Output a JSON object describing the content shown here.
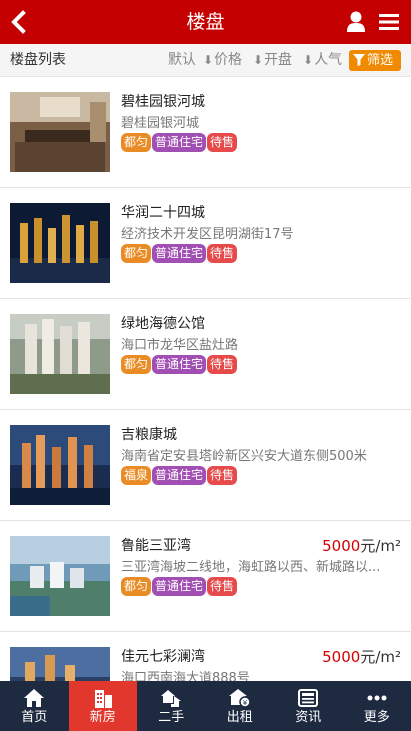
{
  "header": {
    "title": "楼盘"
  },
  "toolbar": {
    "label": "楼盘列表",
    "sort": {
      "default": "默认",
      "price": "价格",
      "open": "开盘",
      "popularity": "人气"
    },
    "filter": "筛选",
    "arrow": "⬇"
  },
  "listings": [
    {
      "name": "碧桂园银河城",
      "address": "碧桂园银河城",
      "price": "",
      "unit": "",
      "tags": [
        "都匀",
        "普通住宅",
        "待售"
      ]
    },
    {
      "name": "华润二十四城",
      "address": "经济技术开发区昆明湖街17号",
      "price": "",
      "unit": "",
      "tags": [
        "都匀",
        "普通住宅",
        "待售"
      ]
    },
    {
      "name": "绿地海德公馆",
      "address": "海口市龙华区盐灶路",
      "price": "",
      "unit": "",
      "tags": [
        "都匀",
        "普通住宅",
        "待售"
      ]
    },
    {
      "name": "吉粮康城",
      "address": "海南省定安县塔岭新区兴安大道东侧500米",
      "price": "",
      "unit": "",
      "tags": [
        "福泉",
        "普通住宅",
        "待售"
      ]
    },
    {
      "name": "鲁能三亚湾",
      "address": "三亚湾海坡二线地，海虹路以西、新城路以...",
      "price": "5000",
      "unit": "元/m²",
      "tags": [
        "都匀",
        "普通住宅",
        "待售"
      ]
    },
    {
      "name": "佳元七彩澜湾",
      "address": "海口西南海大道888号",
      "price": "5000",
      "unit": "元/m²",
      "tags": []
    }
  ],
  "tabbar": [
    {
      "label": "首页",
      "icon": "home-icon"
    },
    {
      "label": "新房",
      "icon": "building-icon"
    },
    {
      "label": "二手",
      "icon": "house-share-icon"
    },
    {
      "label": "出租",
      "icon": "rent-icon"
    },
    {
      "label": "资讯",
      "icon": "news-icon"
    },
    {
      "label": "更多",
      "icon": "more-icon"
    }
  ],
  "colors": {
    "header": "#c40000",
    "filter": "#f08a00",
    "tab_active": "#e2372c",
    "tabbar": "#1e2a40",
    "price": "#d40000"
  }
}
